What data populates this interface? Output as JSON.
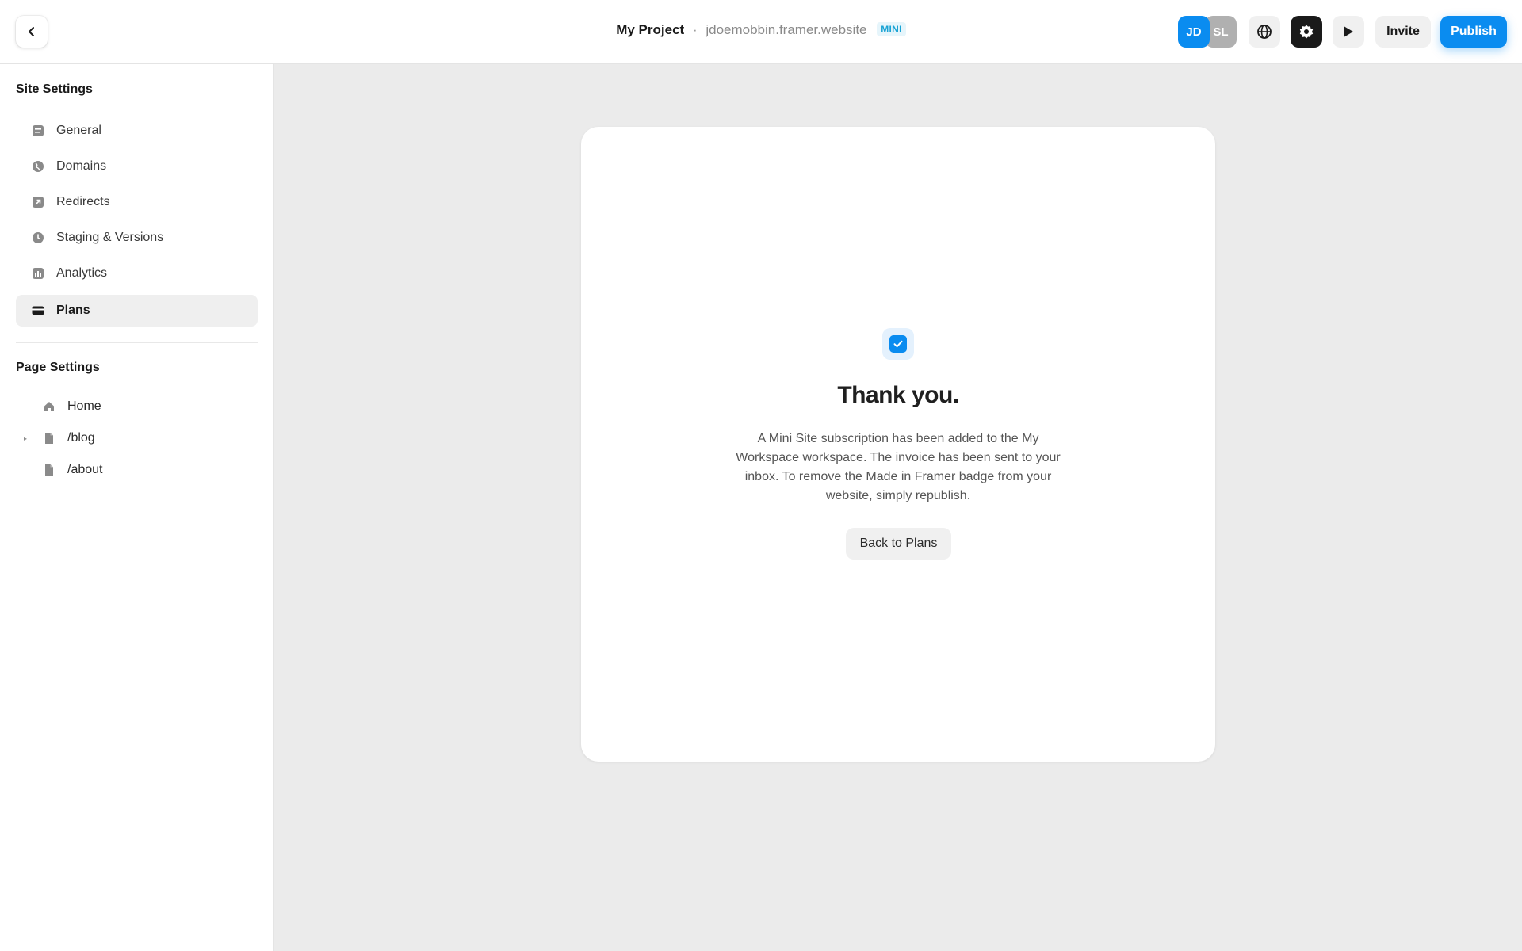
{
  "header": {
    "project_name": "My Project",
    "separator": "·",
    "site_url": "jdoemobbin.framer.website",
    "plan_badge": "MINI",
    "avatars": [
      "JD",
      "SL"
    ],
    "invite_label": "Invite",
    "publish_label": "Publish"
  },
  "sidebar": {
    "site_settings_title": "Site Settings",
    "site_items": [
      {
        "label": "General",
        "icon": "general-icon"
      },
      {
        "label": "Domains",
        "icon": "globe-icon"
      },
      {
        "label": "Redirects",
        "icon": "redirect-icon"
      },
      {
        "label": "Staging & Versions",
        "icon": "clock-icon"
      },
      {
        "label": "Analytics",
        "icon": "analytics-icon"
      },
      {
        "label": "Plans",
        "icon": "card-icon",
        "active": true
      }
    ],
    "page_settings_title": "Page Settings",
    "pages": [
      {
        "label": "Home",
        "icon": "home-icon"
      },
      {
        "label": "/blog",
        "icon": "page-icon",
        "expandable": true
      },
      {
        "label": "/about",
        "icon": "page-icon"
      }
    ]
  },
  "main": {
    "title": "Thank you.",
    "message": "A Mini Site subscription has been added to the My Workspace workspace. The invoice has been sent to your inbox. To remove the Made in Framer badge from your website, simply republish.",
    "back_button": "Back to Plans"
  },
  "colors": {
    "accent": "#0a8cf0",
    "badge_text": "#19a3d4",
    "canvas_bg": "#ebebeb"
  }
}
